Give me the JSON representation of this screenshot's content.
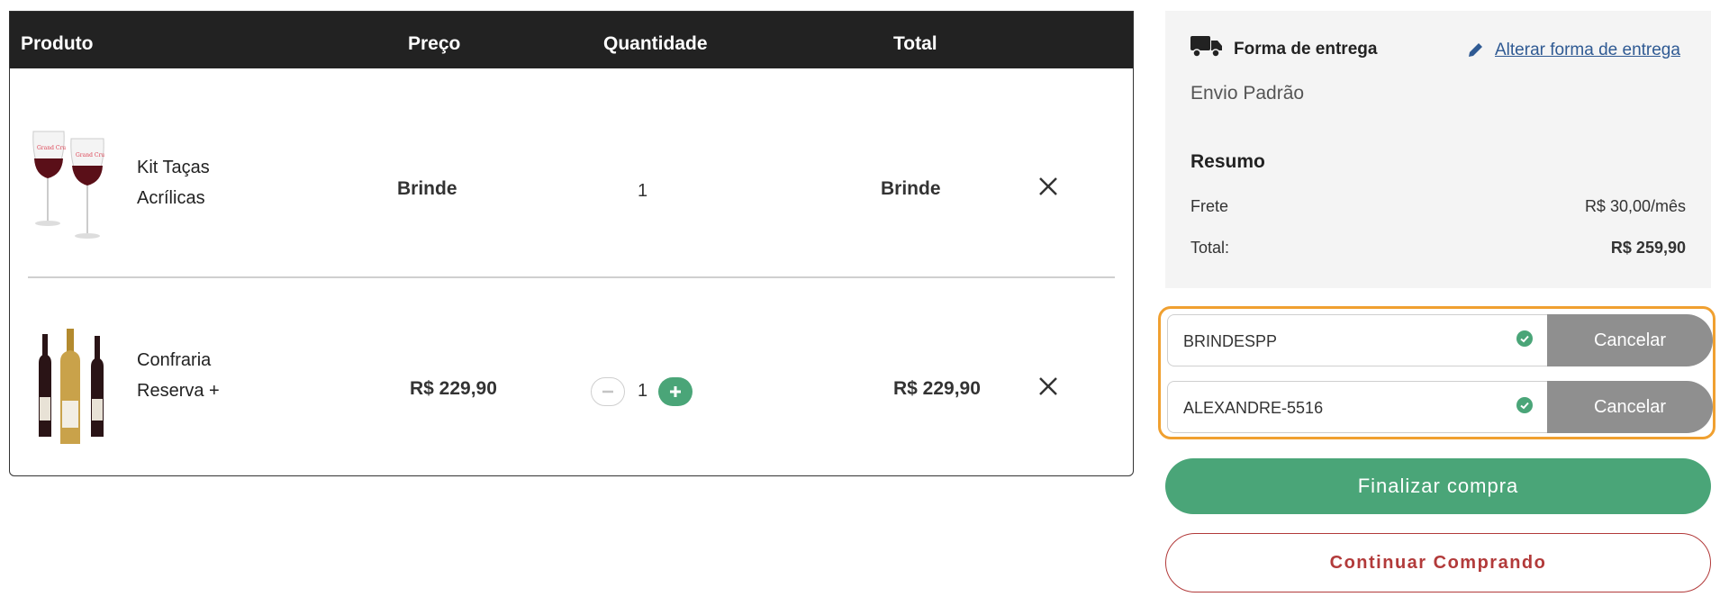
{
  "cart": {
    "headers": {
      "product": "Produto",
      "price": "Preço",
      "quantity": "Quantidade",
      "total": "Total"
    },
    "items": [
      {
        "name_line1": "Kit Taças",
        "name_line2": "Acrílicas",
        "price": "Brinde",
        "quantity": "1",
        "total": "Brinde",
        "icon": "wine-glasses-image"
      },
      {
        "name_line1": "Confraria",
        "name_line2": "Reserva +",
        "price": "R$ 229,90",
        "quantity": "1",
        "total": "R$ 229,90",
        "icon": "wine-bottles-image"
      }
    ]
  },
  "summary": {
    "shipping_title": "Forma de entrega",
    "change_shipping_link": "Alterar forma de entrega",
    "shipping_method": "Envio Padrão",
    "title": "Resumo",
    "freight_label": "Frete",
    "freight_value": "R$ 30,00/mês",
    "total_label": "Total:",
    "total_value": "R$ 259,90"
  },
  "coupons": [
    {
      "code": "BRINDESPP",
      "cancel_label": "Cancelar"
    },
    {
      "code": "ALEXANDRE-5516",
      "cancel_label": "Cancelar"
    }
  ],
  "actions": {
    "finish_label": "Finalizar compra",
    "continue_label": "Continuar Comprando"
  },
  "colors": {
    "header_bg": "#222222",
    "accent_green": "#4aa578",
    "link_blue": "#2f5a93",
    "coupon_border": "#f0a030",
    "continue_red": "#b23a3a",
    "cancel_gray": "#8f8f8f"
  }
}
